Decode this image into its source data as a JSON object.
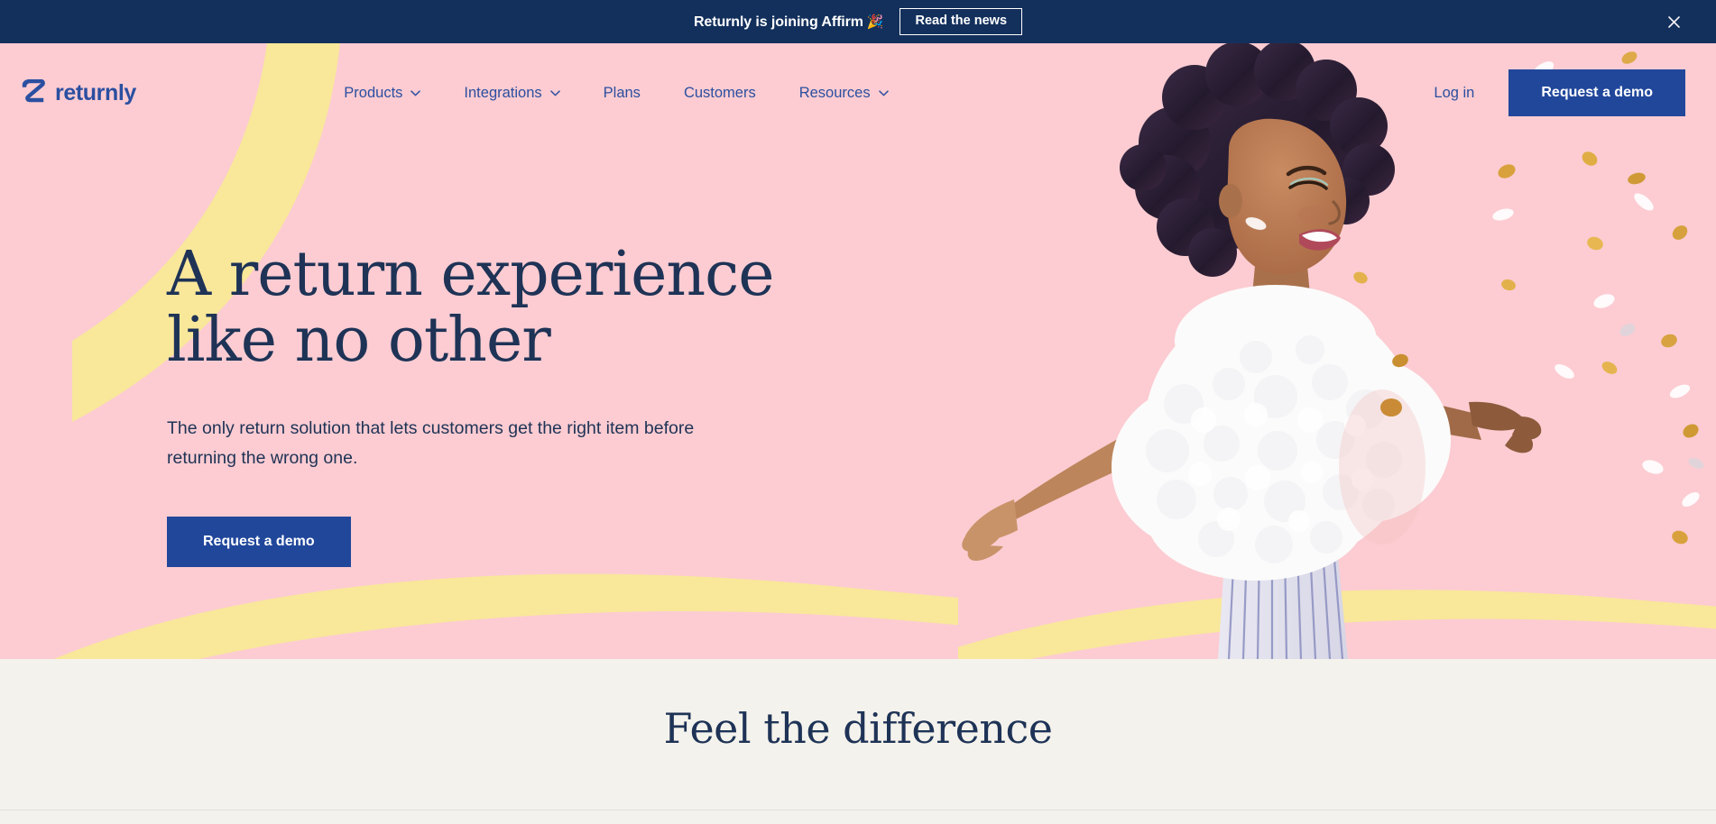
{
  "banner": {
    "text": "Returnly is joining Affirm",
    "emoji": "🎉",
    "cta_label": "Read the news",
    "close_icon": "close-icon",
    "bg_color": "#13305c",
    "text_color": "#ffffff"
  },
  "nav": {
    "logo_text": "returnly",
    "logo_mark_icon": "returnly-z-mark-icon",
    "items": [
      {
        "label": "Products",
        "has_dropdown": true,
        "icon": "chevron-down-icon"
      },
      {
        "label": "Integrations",
        "has_dropdown": true,
        "icon": "chevron-down-icon"
      },
      {
        "label": "Plans",
        "has_dropdown": false,
        "icon": ""
      },
      {
        "label": "Customers",
        "has_dropdown": false,
        "icon": ""
      },
      {
        "label": "Resources",
        "has_dropdown": true,
        "icon": "chevron-down-icon"
      }
    ],
    "login_label": "Log in",
    "demo_label": "Request a demo",
    "link_color": "#2b4fa0",
    "button_color": "#21479b"
  },
  "hero": {
    "title": "A return experience like no other",
    "subtitle": "The only return solution that lets customers get the right item before returning the wrong one.",
    "cta_label": "Request a demo",
    "bg_color": "#fcccd2",
    "accent_color": "#f9e79a",
    "text_color": "#1e3356",
    "image_alt": "smiling woman with arms outstretched and confetti"
  },
  "section2": {
    "title": "Feel the difference",
    "bg_color": "#f4f2ec"
  }
}
